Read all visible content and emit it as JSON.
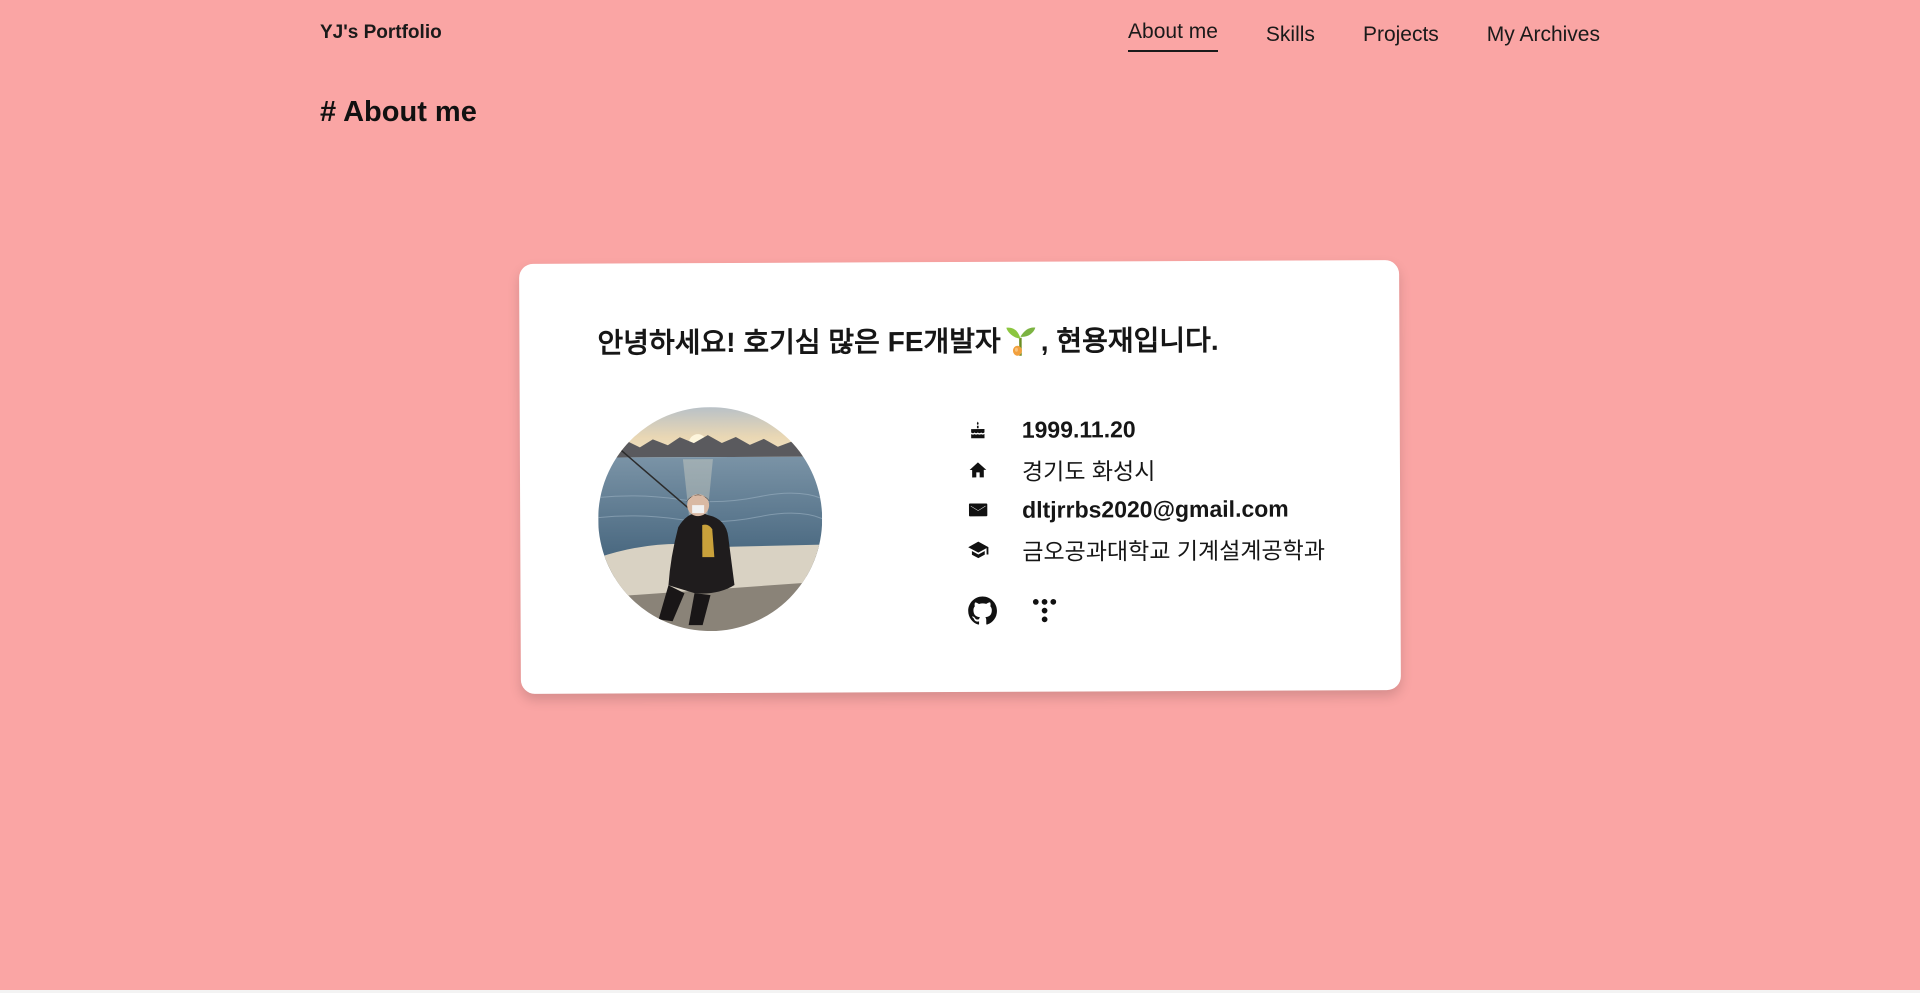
{
  "header": {
    "brand": "YJ's Portfolio",
    "menu": [
      {
        "label": "About me",
        "active": true
      },
      {
        "label": "Skills",
        "active": false
      },
      {
        "label": "Projects",
        "active": false
      },
      {
        "label": "My Archives",
        "active": false
      }
    ]
  },
  "about": {
    "section_title": "# About me",
    "greeting_before": "안녕하세요! 호기심 많은 FE개발자",
    "greeting_emoji": "sprout-icon",
    "greeting_after": ", 현용재입니다.",
    "info": [
      {
        "icon": "birthday-cake-icon",
        "text": "1999.11.20"
      },
      {
        "icon": "home-icon",
        "text": "경기도 화성시"
      },
      {
        "icon": "mail-icon",
        "text": "dltjrrbs2020@gmail.com"
      },
      {
        "icon": "graduation-cap-icon",
        "text": "금오공과대학교 기계설계공학과"
      }
    ],
    "socials": [
      {
        "icon": "github-icon"
      },
      {
        "icon": "tistory-icon"
      }
    ]
  },
  "colors": {
    "background": "#FAA5A4",
    "card": "#FFFFFF",
    "text": "#111111"
  }
}
